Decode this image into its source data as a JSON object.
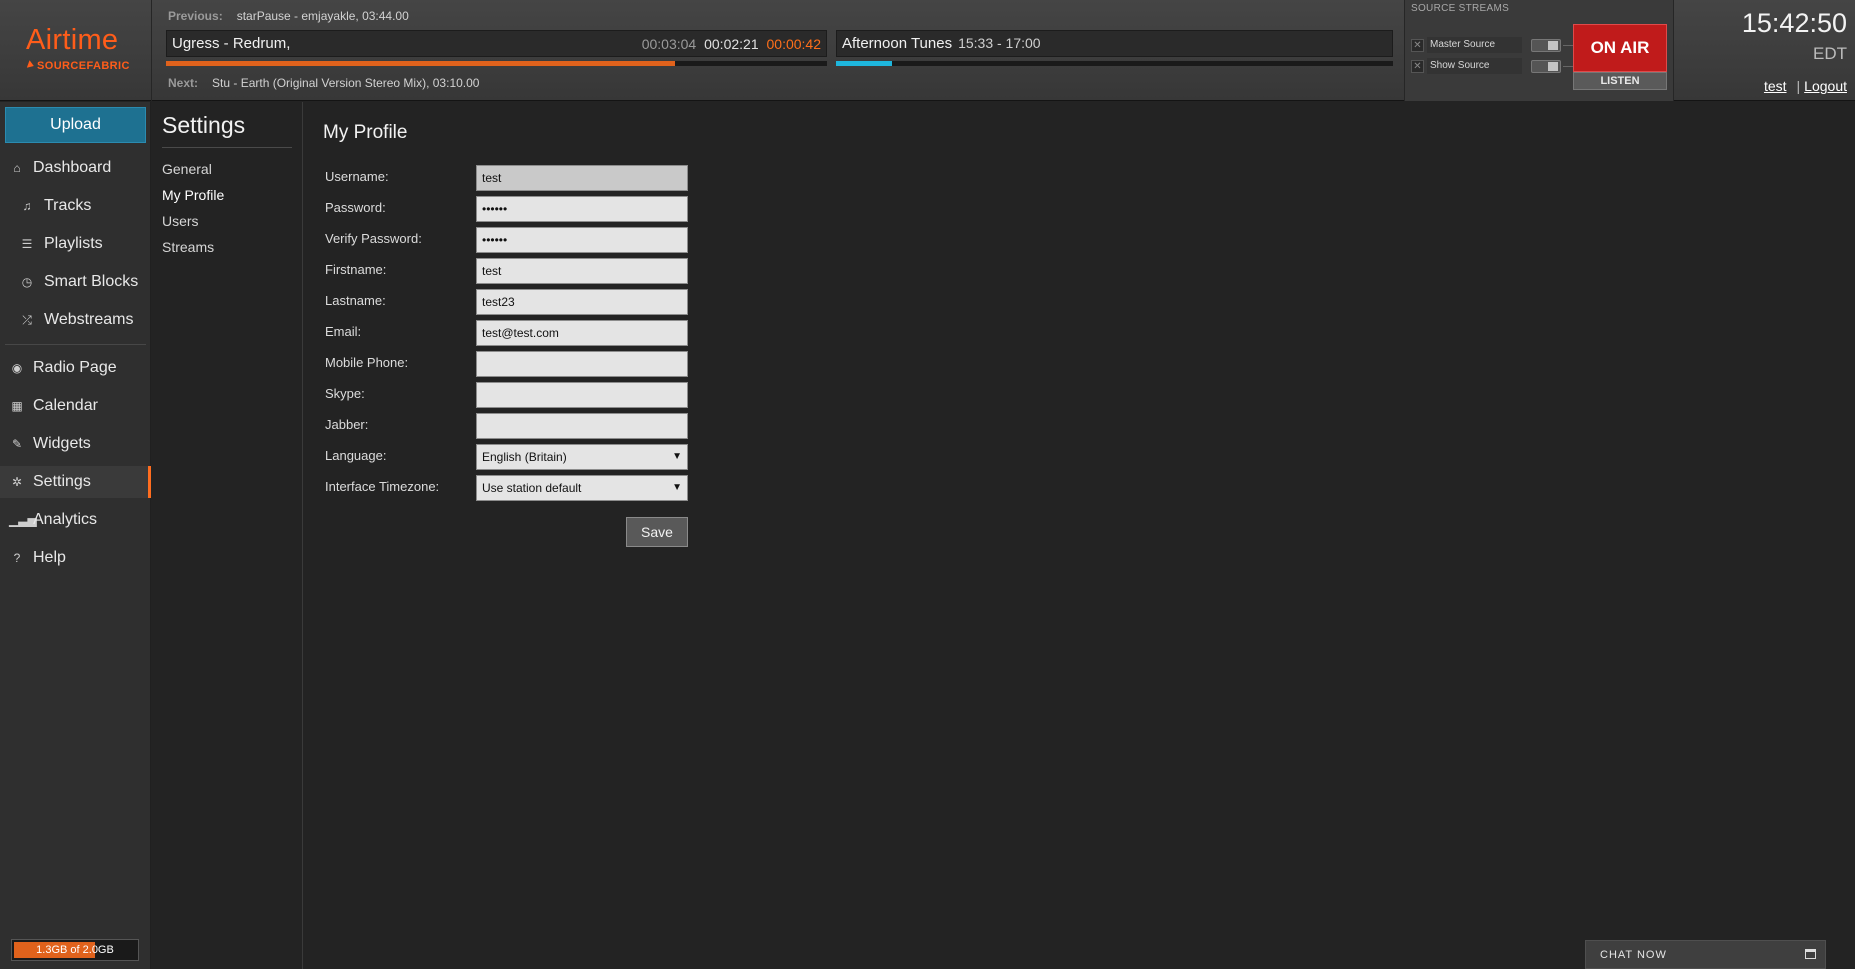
{
  "logo": {
    "name": "Airtime",
    "sub": "SOURCEFABRIC"
  },
  "player": {
    "previous_label": "Previous:",
    "previous": "starPause - emjayakle, 03:44.00",
    "next_label": "Next:",
    "next": "Stu - Earth (Original Version Stereo Mix), 03:10.00",
    "current_track": "Ugress - Redrum,",
    "elapsed": "00:03:04",
    "total": "00:02:21",
    "remaining": "00:00:42",
    "track_progress": 0.77,
    "show_name": "Afternoon Tunes",
    "show_hours": "15:33 - 17:00",
    "show_progress": 0.1
  },
  "sources": {
    "header": "SOURCE STREAMS",
    "items": [
      {
        "label": "Master Source"
      },
      {
        "label": "Show Source"
      }
    ],
    "on_air": "ON AIR",
    "listen": "LISTEN"
  },
  "clock": {
    "time": "15:42:50",
    "tz": "EDT",
    "user": "test",
    "sep": "|",
    "logout": "Logout"
  },
  "sidebar": {
    "upload": "Upload",
    "items": [
      {
        "label": "Dashboard",
        "icon": "home-icon"
      },
      {
        "label": "Tracks",
        "icon": "music-note-icon"
      },
      {
        "label": "Playlists",
        "icon": "list-icon"
      },
      {
        "label": "Smart Blocks",
        "icon": "clock-icon"
      },
      {
        "label": "Webstreams",
        "icon": "shuffle-icon"
      },
      {
        "label": "Radio Page",
        "icon": "globe-icon"
      },
      {
        "label": "Calendar",
        "icon": "calendar-icon"
      },
      {
        "label": "Widgets",
        "icon": "wrench-icon"
      },
      {
        "label": "Settings",
        "icon": "gear-icon"
      },
      {
        "label": "Analytics",
        "icon": "signal-icon"
      },
      {
        "label": "Help",
        "icon": "help-icon"
      }
    ],
    "storage": "1.3GB of 2.0GB",
    "storage_used": 0.65
  },
  "settings_nav": {
    "title": "Settings",
    "items": [
      "General",
      "My Profile",
      "Users",
      "Streams"
    ]
  },
  "profile": {
    "heading": "My Profile",
    "fields": [
      {
        "label": "Username:",
        "value": "test"
      },
      {
        "label": "Password:",
        "value": "••••••"
      },
      {
        "label": "Verify Password:",
        "value": "••••••"
      },
      {
        "label": "Firstname:",
        "value": "test"
      },
      {
        "label": "Lastname:",
        "value": "test23"
      },
      {
        "label": "Email:",
        "value": "test@test.com"
      },
      {
        "label": "Mobile Phone:",
        "value": ""
      },
      {
        "label": "Skype:",
        "value": ""
      },
      {
        "label": "Jabber:",
        "value": ""
      }
    ],
    "language_label": "Language:",
    "language": "English (Britain)",
    "timezone_label": "Interface Timezone:",
    "timezone": "Use station default",
    "save": "Save"
  },
  "chat": {
    "label": "CHAT NOW"
  },
  "colors": {
    "accent": "#ff5d1a",
    "upload": "#1e7191",
    "on_air": "#c01b1b",
    "show_bar": "#1eb6dd"
  }
}
